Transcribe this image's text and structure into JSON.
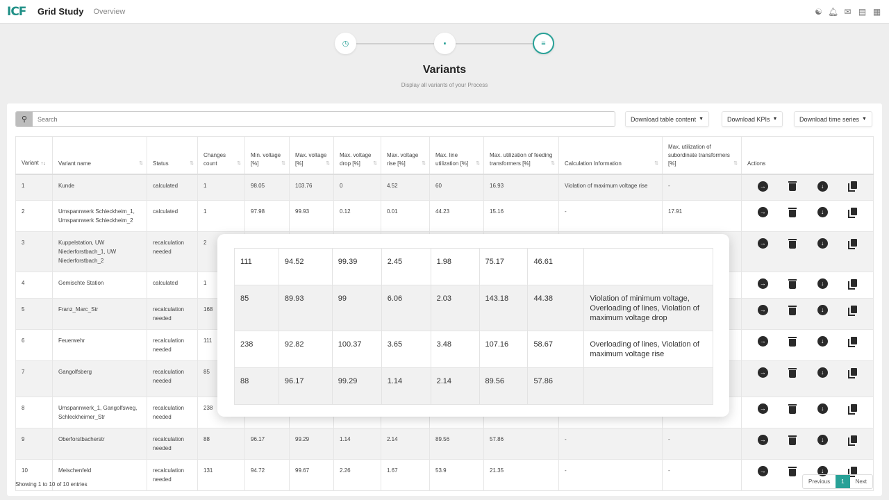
{
  "header": {
    "logo": "ICF",
    "title": "Grid Study",
    "nav": "Overview",
    "icons": [
      "people-icon",
      "bell-icon",
      "mail-icon",
      "document-icon",
      "grid-icon"
    ]
  },
  "stepper": {
    "steps": [
      {
        "icon": "clock-icon",
        "active": false
      },
      {
        "icon": "clipboard-icon",
        "active": false
      },
      {
        "icon": "list-icon",
        "active": true
      }
    ]
  },
  "page": {
    "title": "Variants",
    "subtitle": "Display all variants of your Process"
  },
  "toolbar": {
    "search_placeholder": "Search",
    "search_value": "",
    "download_table": "Download table content",
    "download_kpis": "Download KPIs",
    "download_timeseries": "Download time series"
  },
  "table": {
    "columns": [
      "Variant",
      "Variant name",
      "Status",
      "Changes count",
      "Min. voltage [%]",
      "Max. voltage [%]",
      "Max. voltage drop [%]",
      "Max. voltage rise [%]",
      "Max. line utilization [%]",
      "Max. utilization of feeding transformers [%]",
      "Calculation Information",
      "Max. utilization of subordinate transformers [%]",
      "Actions"
    ],
    "sort_active": "Variant",
    "rows": [
      {
        "variant": "1",
        "name": "Kunde",
        "status": "calculated",
        "changes": "1",
        "min_v": "98.05",
        "max_v": "103.76",
        "drop": "0",
        "rise": "4.52",
        "line_util": "60",
        "feed_tr": "16.93",
        "info": "Violation of maximum voltage rise",
        "sub_tr": "-"
      },
      {
        "variant": "2",
        "name": "Umspannwerk Schleckheim_1, Umspannwerk Schleckheim_2",
        "status": "calculated",
        "changes": "1",
        "min_v": "97.98",
        "max_v": "99.93",
        "drop": "0.12",
        "rise": "0.01",
        "line_util": "44.23",
        "feed_tr": "15.16",
        "info": "-",
        "sub_tr": "17.91"
      },
      {
        "variant": "3",
        "name": "Kuppelstation, UW Niederforstbach_1, UW Niederforstbach_2",
        "status": "recalculation needed",
        "changes": "2",
        "min_v": "",
        "max_v": "",
        "drop": "",
        "rise": "",
        "line_util": "",
        "feed_tr": "",
        "info": "",
        "sub_tr": ""
      },
      {
        "variant": "4",
        "name": "Gemischte Station",
        "status": "calculated",
        "changes": "1",
        "min_v": "",
        "max_v": "",
        "drop": "",
        "rise": "",
        "line_util": "",
        "feed_tr": "",
        "info": "",
        "sub_tr": ""
      },
      {
        "variant": "5",
        "name": "Franz_Marc_Str",
        "status": "recalculation needed",
        "changes": "168",
        "min_v": "",
        "max_v": "",
        "drop": "",
        "rise": "",
        "line_util": "",
        "feed_tr": "",
        "info": "",
        "sub_tr": ""
      },
      {
        "variant": "6",
        "name": "Feuerwehr",
        "status": "recalculation needed",
        "changes": "111",
        "min_v": "",
        "max_v": "",
        "drop": "",
        "rise": "",
        "line_util": "",
        "feed_tr": "",
        "info": "",
        "sub_tr": ""
      },
      {
        "variant": "7",
        "name": "Gangolfsberg",
        "status": "recalculation needed",
        "changes": "85",
        "min_v": "",
        "max_v": "",
        "drop": "",
        "rise": "",
        "line_util": "",
        "feed_tr": "",
        "info": "",
        "sub_tr": ""
      },
      {
        "variant": "8",
        "name": "Umspannwerk_1, Gangolfsweg, Schleckheimer_Str",
        "status": "recalculation needed",
        "changes": "238",
        "min_v": "",
        "max_v": "",
        "drop": "",
        "rise": "",
        "line_util": "",
        "feed_tr": "",
        "info": "",
        "sub_tr": ""
      },
      {
        "variant": "9",
        "name": "Oberforstbacherstr",
        "status": "recalculation needed",
        "changes": "88",
        "min_v": "96.17",
        "max_v": "99.29",
        "drop": "1.14",
        "rise": "2.14",
        "line_util": "89.56",
        "feed_tr": "57.86",
        "info": "-",
        "sub_tr": "-"
      },
      {
        "variant": "10",
        "name": "Meischenfeld",
        "status": "recalculation needed",
        "changes": "131",
        "min_v": "94.72",
        "max_v": "99.67",
        "drop": "2.26",
        "rise": "1.67",
        "line_util": "53.9",
        "feed_tr": "21.35",
        "info": "-",
        "sub_tr": "-"
      }
    ],
    "action_icons": [
      "arrow-right-circle-icon",
      "trash-icon",
      "download-circle-icon",
      "copy-icon"
    ]
  },
  "zoom_overlay": {
    "rows": [
      {
        "changes": "111",
        "min_v": "94.52",
        "max_v": "99.39",
        "drop": "2.45",
        "rise": "1.98",
        "line_util": "75.17",
        "feed_tr": "46.61",
        "info": ""
      },
      {
        "changes": "85",
        "min_v": "89.93",
        "max_v": "99",
        "drop": "6.06",
        "rise": "2.03",
        "line_util": "143.18",
        "feed_tr": "44.38",
        "info": "Violation of minimum voltage, Overloading of lines, Violation of maximum voltage drop"
      },
      {
        "changes": "238",
        "min_v": "92.82",
        "max_v": "100.37",
        "drop": "3.65",
        "rise": "3.48",
        "line_util": "107.16",
        "feed_tr": "58.67",
        "info": "Overloading of lines, Violation of maximum voltage rise"
      },
      {
        "changes": "88",
        "min_v": "96.17",
        "max_v": "99.29",
        "drop": "1.14",
        "rise": "2.14",
        "line_util": "89.56",
        "feed_tr": "57.86",
        "info": ""
      }
    ]
  },
  "footer": {
    "info": "Showing 1 to 10 of 10 entries",
    "prev": "Previous",
    "current_page": "1",
    "next": "Next"
  },
  "colors": {
    "accent": "#28a197",
    "icon_dark": "#2a2a2a"
  }
}
